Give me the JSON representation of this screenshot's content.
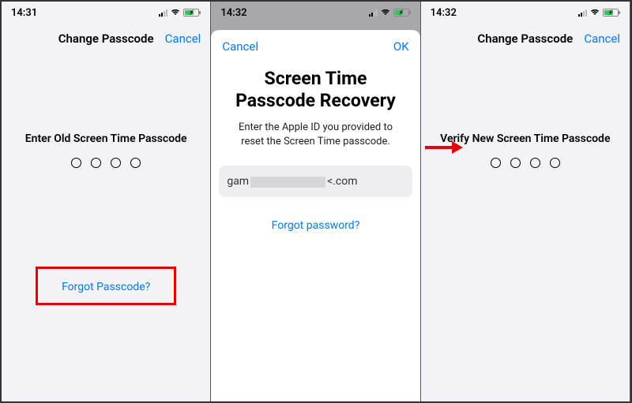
{
  "screen1": {
    "time": "14:31",
    "nav_title": "Change Passcode",
    "cancel": "Cancel",
    "prompt": "Enter Old Screen Time Passcode",
    "forgot": "Forgot Passcode?"
  },
  "screen2": {
    "time": "14:32",
    "cancel": "Cancel",
    "ok": "OK",
    "title_line1": "Screen Time",
    "title_line2": "Passcode Recovery",
    "subtitle": "Enter the Apple ID you provided to reset the Screen Time passcode.",
    "email_prefix": "gam",
    "email_suffix": "<.com",
    "forgot_pw": "Forgot password?"
  },
  "screen3": {
    "time": "14:32",
    "nav_title": "Change Passcode",
    "cancel": "Cancel",
    "prompt": "Verify New Screen Time Passcode"
  }
}
